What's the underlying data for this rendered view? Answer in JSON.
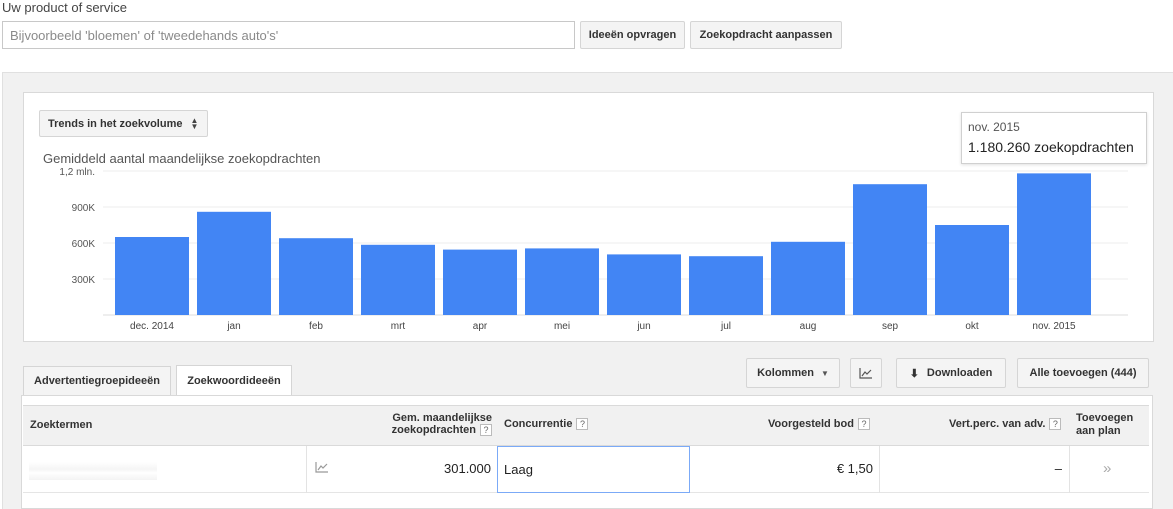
{
  "search": {
    "label": "Uw product of service",
    "placeholder": "Bijvoorbeeld 'bloemen' of 'tweedehands auto's'",
    "ideas_button": "Ideeën opvragen",
    "adjust_button": "Zoekopdracht aanpassen"
  },
  "chart_panel": {
    "dropdown_label": "Trends in het zoekvolume",
    "tooltip_month": "nov. 2015",
    "tooltip_value": "1.180.260 zoekopdrachten"
  },
  "chart_data": {
    "type": "bar",
    "title": "Gemiddeld aantal maandelijkse zoekopdrachten",
    "categories": [
      "dec. 2014",
      "jan",
      "feb",
      "mrt",
      "apr",
      "mei",
      "jun",
      "jul",
      "aug",
      "sep",
      "okt",
      "nov. 2015"
    ],
    "values": [
      650000,
      860000,
      640000,
      585000,
      545000,
      555000,
      505000,
      490000,
      610000,
      1090000,
      750000,
      1180260
    ],
    "ylim": [
      0,
      1200000
    ],
    "yticks": [
      300000,
      600000,
      900000,
      1200000
    ],
    "ytick_labels": [
      "300K",
      "600K",
      "900K",
      "1,2 mln."
    ],
    "grid": true,
    "colors": {
      "bar": "#4285f4",
      "highlight": "#4285f4"
    }
  },
  "tabs": [
    {
      "label": "Advertentiegroepideeën",
      "active": false
    },
    {
      "label": "Zoekwoordideeën",
      "active": true
    }
  ],
  "actions": {
    "columns": "Kolommen",
    "download": "Downloaden",
    "add_all": "Alle toevoegen (444)"
  },
  "table": {
    "headers": {
      "terms": "Zoektermen",
      "monthly": "Gem. maandelijkse zoekopdrachten",
      "competition": "Concurrentie",
      "bid": "Voorgesteld bod",
      "share": "Vert.perc. van adv.",
      "add": "Toevoegen aan plan"
    },
    "rows": [
      {
        "term": "",
        "monthly": "301.000",
        "competition": "Laag",
        "bid": "€ 1,50",
        "share": "–"
      }
    ]
  }
}
